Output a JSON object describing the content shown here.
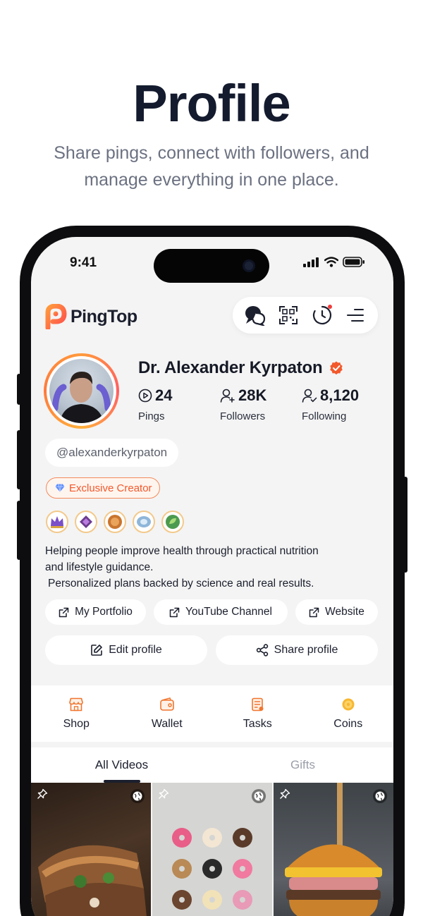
{
  "marketing": {
    "title": "Profile",
    "subtitle": "Share pings, connect with followers, and manage everything in one place."
  },
  "status_bar": {
    "time": "9:41"
  },
  "app": {
    "name": "PingTop"
  },
  "profile": {
    "name": "Dr. Alexander Kyrpaton",
    "verified": true,
    "handle": "@alexanderkyrpaton",
    "creator_badge": "Exclusive Creator",
    "stats": [
      {
        "value": "24",
        "label": "Pings",
        "icon": "play-circle-icon"
      },
      {
        "value": "28K",
        "label": "Followers",
        "icon": "user-plus-icon"
      },
      {
        "value": "8,120",
        "label": "Following",
        "icon": "user-check-icon"
      }
    ],
    "achievement_badges": [
      "crown-badge",
      "gem-badge",
      "shield-badge",
      "wings-badge",
      "leaf-badge"
    ],
    "bio_line_1": "Helping people improve health through practical nutrition",
    "bio_line_2": "and lifestyle guidance.",
    "bio_line_3": "Personalized plans backed by science and real results."
  },
  "links": [
    {
      "label": "My Portfolio"
    },
    {
      "label": "YouTube Channel"
    },
    {
      "label": "Website"
    }
  ],
  "actions": {
    "edit_label": "Edit profile",
    "share_label": "Share profile"
  },
  "shortcuts": [
    {
      "label": "Shop",
      "icon": "shop-icon"
    },
    {
      "label": "Wallet",
      "icon": "wallet-icon"
    },
    {
      "label": "Tasks",
      "icon": "tasks-icon"
    },
    {
      "label": "Coins",
      "icon": "coin-icon"
    }
  ],
  "tabs": [
    {
      "label": "All Videos",
      "active": true
    },
    {
      "label": "Gifts",
      "active": false
    }
  ],
  "videos": [
    {
      "subject": "sandwich",
      "pinned": true,
      "public": true
    },
    {
      "subject": "donuts",
      "pinned": true,
      "public": true
    },
    {
      "subject": "burger",
      "pinned": true,
      "public": true
    }
  ],
  "colors": {
    "accent": "#f2582b",
    "brand": "#ff6b2c",
    "text": "#1b1f2d",
    "muted": "#6b7181"
  }
}
